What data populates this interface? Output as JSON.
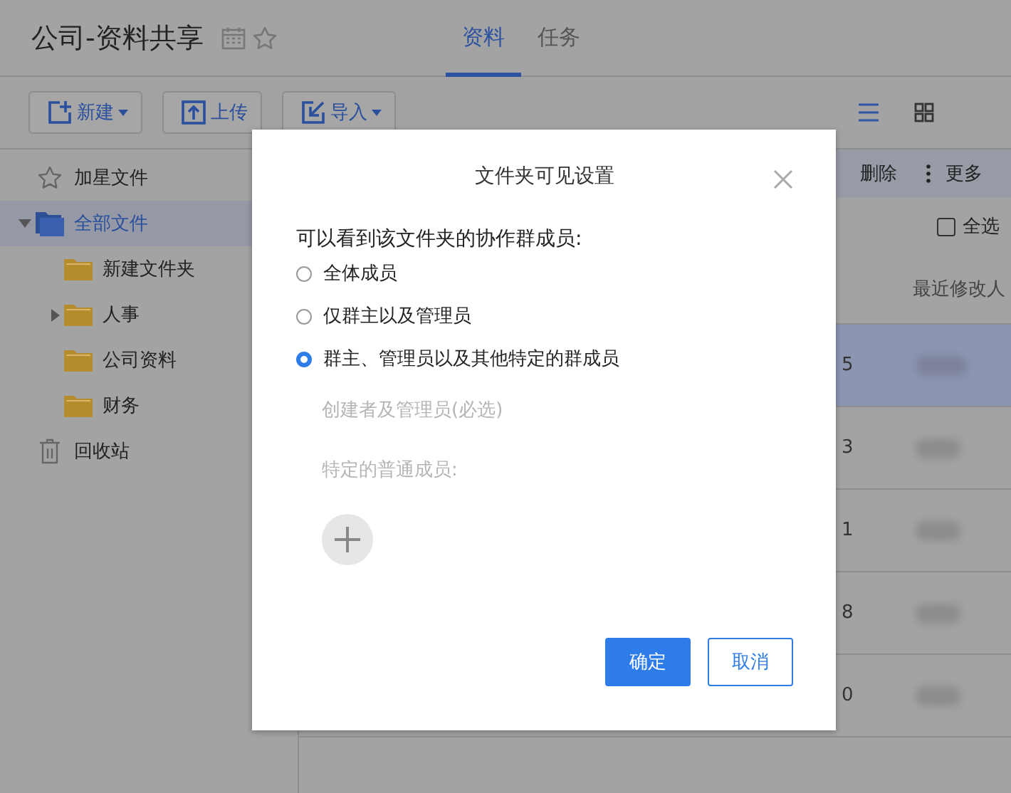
{
  "header": {
    "title": "公司-资料共享",
    "tabs": [
      {
        "label": "资料",
        "selected": true
      },
      {
        "label": "任务",
        "selected": false
      }
    ]
  },
  "toolbar": {
    "buttons": [
      {
        "label": "新建",
        "kind": "menu"
      },
      {
        "label": "上传",
        "kind": "plain"
      },
      {
        "label": "导入",
        "kind": "menu"
      }
    ],
    "view_modes": [
      {
        "kind": "list",
        "selected": true
      },
      {
        "kind": "grid",
        "selected": false
      }
    ]
  },
  "sidebar": {
    "items": [
      {
        "label": "加星文件",
        "kind": "star",
        "selected": false
      },
      {
        "label": "全部文件",
        "kind": "root",
        "selected": true,
        "expanded": true,
        "children": [
          {
            "label": "新建文件夹",
            "kind": "folder",
            "selected": false
          },
          {
            "label": "人事",
            "kind": "parent",
            "selected": false,
            "expanded": false
          },
          {
            "label": "公司资料",
            "kind": "folder",
            "selected": false
          },
          {
            "label": "财务",
            "kind": "folder",
            "selected": false
          }
        ]
      },
      {
        "label": "回收站",
        "kind": "trash",
        "selected": false
      }
    ]
  },
  "action_bar": [
    {
      "label": "删除",
      "kind": "plain"
    },
    {
      "label": "更多",
      "kind": "more"
    }
  ],
  "select_all": {
    "label": "全选",
    "checked": false
  },
  "table": {
    "columns": [
      "最近修改人"
    ],
    "rows": [
      {
        "column_1": "5",
        "selected": true
      },
      {
        "column_1": "3",
        "selected": false
      },
      {
        "column_1": "1",
        "selected": false
      },
      {
        "column_1": "8",
        "selected": false
      },
      {
        "column_1": "0",
        "selected": false
      }
    ]
  },
  "dialog": {
    "title": "文件夹可见设置",
    "prompt": "可以看到该文件夹的协作群成员:",
    "options": [
      {
        "label": "全体成员",
        "selected": false
      },
      {
        "label": "仅群主以及管理员",
        "selected": false
      },
      {
        "label": "群主、管理员以及其他特定的群成员",
        "selected": true
      }
    ],
    "required_label": "创建者及管理员(必选)",
    "members_label": "特定的普通成员:",
    "buttons": [
      {
        "label": "确定",
        "kind": "primary"
      },
      {
        "label": "取消",
        "kind": "secondary"
      }
    ]
  }
}
